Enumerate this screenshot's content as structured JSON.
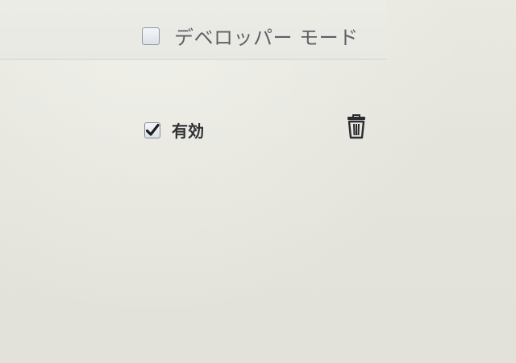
{
  "developer_mode": {
    "label": "デベロッパー モード",
    "checked": false
  },
  "extension": {
    "enabled_label": "有効",
    "enabled_checked": true,
    "remove_icon": "trash-icon"
  },
  "colors": {
    "background": "#e6e6de",
    "label_gray": "#5d6168",
    "label_dark": "#2e3034",
    "checkbox_border": "#8a96a6"
  }
}
